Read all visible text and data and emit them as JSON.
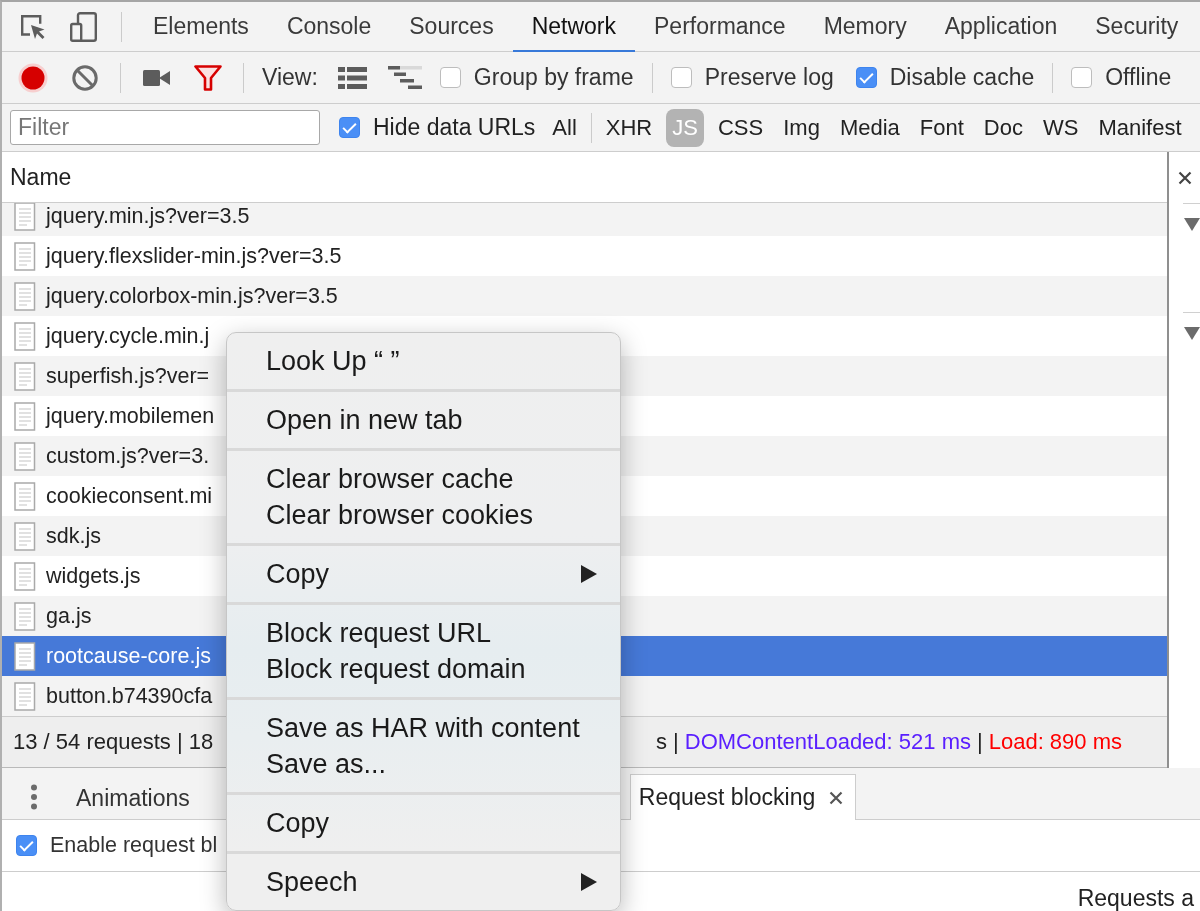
{
  "main_tabs": [
    {
      "label": "Elements",
      "selected": false
    },
    {
      "label": "Console",
      "selected": false
    },
    {
      "label": "Sources",
      "selected": false
    },
    {
      "label": "Network",
      "selected": true
    },
    {
      "label": "Performance",
      "selected": false
    },
    {
      "label": "Memory",
      "selected": false
    },
    {
      "label": "Application",
      "selected": false
    },
    {
      "label": "Security",
      "selected": false
    }
  ],
  "network_toolbar": {
    "recording": true,
    "filter_active": true,
    "view_label": "View:",
    "checkbox_groups": [
      [
        {
          "label": "Group by frame",
          "checked": false
        }
      ],
      [
        {
          "label": "Preserve log",
          "checked": false
        },
        {
          "label": "Disable cache",
          "checked": true
        }
      ],
      [
        {
          "label": "Offline",
          "checked": false
        }
      ]
    ]
  },
  "filter_bar": {
    "filter_field": {
      "placeholder": "Filter"
    },
    "hide_data_urls": {
      "label": "Hide data URLs",
      "checked": true
    },
    "all_filter": {
      "label": "All",
      "selected": false
    },
    "type_filters": [
      {
        "label": "XHR",
        "selected": false
      },
      {
        "label": "JS",
        "selected": true
      },
      {
        "label": "CSS",
        "selected": false
      },
      {
        "label": "Img",
        "selected": false
      },
      {
        "label": "Media",
        "selected": false
      },
      {
        "label": "Font",
        "selected": false
      },
      {
        "label": "Doc",
        "selected": false
      },
      {
        "label": "WS",
        "selected": false
      },
      {
        "label": "Manifest",
        "selected": false
      }
    ]
  },
  "requests_table": {
    "columns": [
      "Name"
    ],
    "rows": [
      {
        "name": "jquery.min.js?ver=3.5",
        "selected": false
      },
      {
        "name": "jquery.flexslider-min.js?ver=3.5",
        "selected": false
      },
      {
        "name": "jquery.colorbox-min.js?ver=3.5",
        "selected": false
      },
      {
        "name": "jquery.cycle.min.j",
        "selected": false
      },
      {
        "name": "superfish.js?ver=",
        "selected": false
      },
      {
        "name": "jquery.mobilemen",
        "selected": false
      },
      {
        "name": "custom.js?ver=3.",
        "selected": false
      },
      {
        "name": "cookieconsent.mi",
        "selected": false
      },
      {
        "name": "sdk.js",
        "selected": false
      },
      {
        "name": "widgets.js",
        "selected": false
      },
      {
        "name": "ga.js",
        "selected": false
      },
      {
        "name": "rootcause-core.js",
        "selected": true
      },
      {
        "name": "button.b74390cfa",
        "selected": false
      }
    ]
  },
  "detail_panel": {
    "sections": [
      {
        "expanded": true
      },
      {
        "expanded": true
      }
    ]
  },
  "status_bar": {
    "summary": "13 / 54 requests | 18",
    "timings": [
      {
        "text": "s |",
        "kind": "plain"
      },
      {
        "text": "DOMContentLoaded: 521 ms",
        "kind": "dom_content_loaded"
      },
      {
        "text": "|",
        "kind": "plain"
      },
      {
        "text": "Load: 890 ms",
        "kind": "load"
      }
    ]
  },
  "drawer": {
    "tabs": [
      {
        "label": "Animations",
        "selected": false,
        "closable": false
      },
      {
        "label": "Request blocking",
        "selected": true,
        "closable": true
      }
    ],
    "enable_blocking": {
      "label": "Enable request bl",
      "checked": true
    },
    "hint": "Requests a"
  },
  "context_menu": {
    "groups": [
      [
        {
          "label": "Look Up “ ”",
          "submenu": false
        }
      ],
      [
        {
          "label": "Open in new tab",
          "submenu": false
        }
      ],
      [
        {
          "label": "Clear browser cache",
          "submenu": false
        },
        {
          "label": "Clear browser cookies",
          "submenu": false
        }
      ],
      [
        {
          "label": "Copy",
          "submenu": true
        }
      ],
      [
        {
          "label": "Block request URL",
          "submenu": false
        },
        {
          "label": "Block request domain",
          "submenu": false
        }
      ],
      [
        {
          "label": "Save as HAR with content",
          "submenu": false
        },
        {
          "label": "Save as...",
          "submenu": false
        }
      ],
      [
        {
          "label": "Copy",
          "submenu": false
        }
      ],
      [
        {
          "label": "Speech",
          "submenu": true
        }
      ]
    ]
  }
}
